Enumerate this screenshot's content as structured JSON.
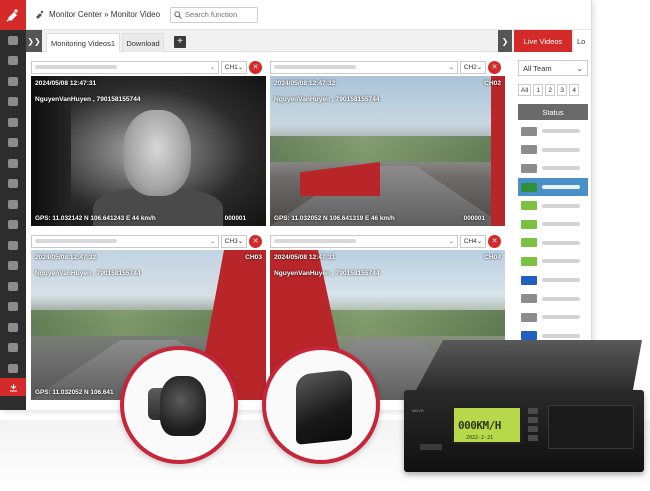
{
  "header": {
    "breadcrumb": "Monitor Center » Monitor Video",
    "search_placeholder": "Search function"
  },
  "tabs": [
    {
      "label": "Monitoring Videos1"
    },
    {
      "label": "Download"
    }
  ],
  "right_tabs": {
    "live": "Live Videos",
    "other": "Lo"
  },
  "videos": [
    {
      "channel_select": "CH1",
      "timestamp": "2024/05/08  12:47:31",
      "ch_label": "",
      "driver": "NguyenVanHuyen , 790158155744",
      "gps": "GPS: 11.032142 N  106.641243 E    44 km/h",
      "frame": "000001"
    },
    {
      "channel_select": "CH2",
      "timestamp": "2024/05/08  12:47:32",
      "ch_label": "CH02",
      "driver": "NguyenVanHuyen , 790158155744",
      "gps": "GPS: 11.032052 N  106.641319 E    46 km/h",
      "frame": "000001"
    },
    {
      "channel_select": "CH3",
      "timestamp": "2024/05/08  12:47:32",
      "ch_label": "CH03",
      "driver": "NguyenVanHuyen , 790158155744",
      "gps": "GPS: 11.032052 N  106.641",
      "frame": ""
    },
    {
      "channel_select": "CH4",
      "timestamp": "2024/05/08  12:47:31",
      "ch_label": "CH04",
      "driver": "NguyenVanHuyen , 790158155744",
      "gps": "",
      "frame": ""
    }
  ],
  "right_panel": {
    "team_select": "All Team",
    "pages": [
      "All",
      "1",
      "2",
      "3",
      "4"
    ],
    "status_header": "Status",
    "vehicle_colors": [
      "#8c8c8c",
      "#8c8c8c",
      "#8c8c8c",
      "#2f8f3a",
      "#7ac142",
      "#7ac142",
      "#7ac142",
      "#7ac142",
      "#2060c0",
      "#8c8c8c",
      "#8c8c8c",
      "#2060c0"
    ]
  },
  "device": {
    "speed": "000KM/H",
    "date": "2022-2-21",
    "label": "MDVR"
  },
  "icons": {
    "logo": "satellite-dish-icon",
    "search": "search-icon",
    "mute": "speaker-muted-icon",
    "add": "plus-icon"
  },
  "colors": {
    "brand_red": "#d42a2a",
    "sidebar": "#2d2d2d",
    "selected_row": "#4a90c8"
  }
}
